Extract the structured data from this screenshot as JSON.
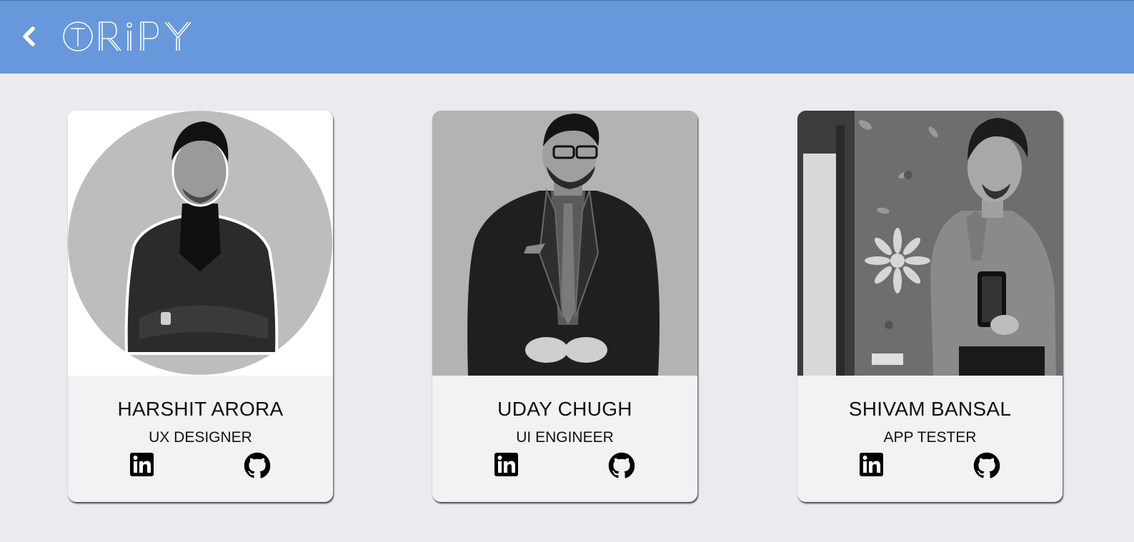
{
  "header": {
    "logo_text": "TRIPY",
    "background_color": "#6798dc",
    "back_icon": "chevron-left-icon"
  },
  "team": [
    {
      "name": "HARSHIT ARORA",
      "role": "UX DESIGNER",
      "links": [
        {
          "icon": "linkedin-icon"
        },
        {
          "icon": "github-icon"
        }
      ]
    },
    {
      "name": "UDAY CHUGH",
      "role": "UI ENGINEER",
      "links": [
        {
          "icon": "linkedin-icon"
        },
        {
          "icon": "github-icon"
        }
      ]
    },
    {
      "name": "SHIVAM BANSAL",
      "role": "APP TESTER",
      "links": [
        {
          "icon": "linkedin-icon"
        },
        {
          "icon": "github-icon"
        }
      ]
    }
  ]
}
